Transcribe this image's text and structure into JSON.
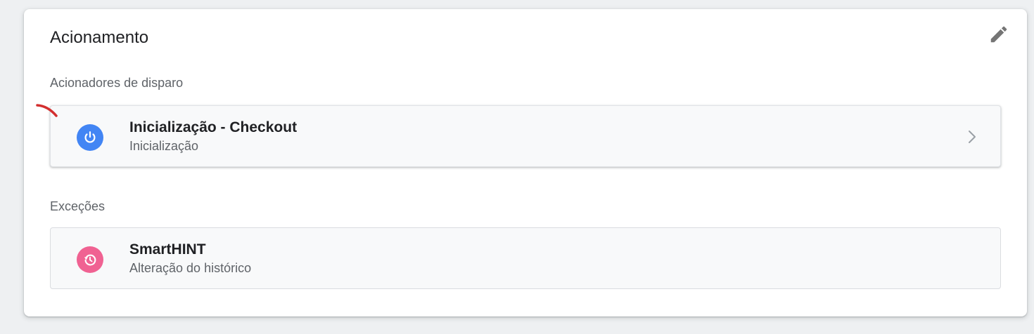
{
  "card": {
    "title": "Acionamento"
  },
  "firing": {
    "label": "Acionadores de disparo",
    "triggers": [
      {
        "name": "Inicialização - Checkout",
        "type": "Inicialização",
        "icon": "power-icon",
        "icon_color": "#4285f4"
      }
    ]
  },
  "exceptions": {
    "label": "Exceções",
    "triggers": [
      {
        "name": "SmartHINT",
        "type": "Alteração do histórico",
        "icon": "history-icon",
        "icon_color": "#f06292"
      }
    ]
  },
  "colors": {
    "background": "#eef0f2",
    "card": "#ffffff",
    "text_primary": "#202124",
    "text_secondary": "#5f6368",
    "annotation": "#d32f2f"
  }
}
